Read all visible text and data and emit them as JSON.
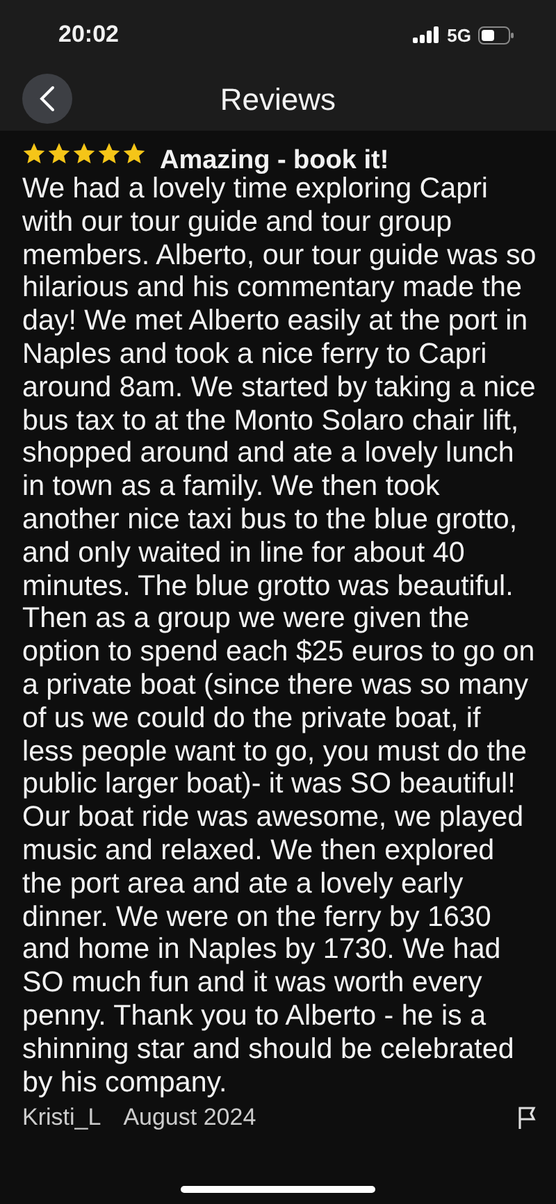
{
  "status_bar": {
    "time": "20:02",
    "network": "5G"
  },
  "header": {
    "title": "Reviews"
  },
  "review": {
    "stars": 5,
    "title": "Amazing - book it!",
    "body": "We had a lovely time exploring Capri with our tour guide and tour group members. Alberto, our tour guide was so hilarious and his commentary made the day! We met Alberto easily at the port in Naples and took a nice ferry to Capri around 8am. We started by taking a nice bus tax to at the Monto Solaro chair lift, shopped around and ate a lovely lunch in town as a family. We then took another nice taxi bus to the blue grotto, and only waited in line for about 40 minutes. The blue grotto was beautiful. Then as a group we were given the option to spend each $25 euros to go on a private boat (since there was so many of us we could do the private boat, if less people want to go, you must do the public larger boat)- it was SO beautiful! Our boat ride was awesome, we played music and relaxed. We then explored the port area and ate a lovely early dinner. We were on the ferry by 1630 and home in Naples by 1730. We had SO much fun and it was worth every penny. Thank you to Alberto - he is a shinning star and should be celebrated by his company.",
    "author": "Kristi_L",
    "date": "August 2024"
  }
}
